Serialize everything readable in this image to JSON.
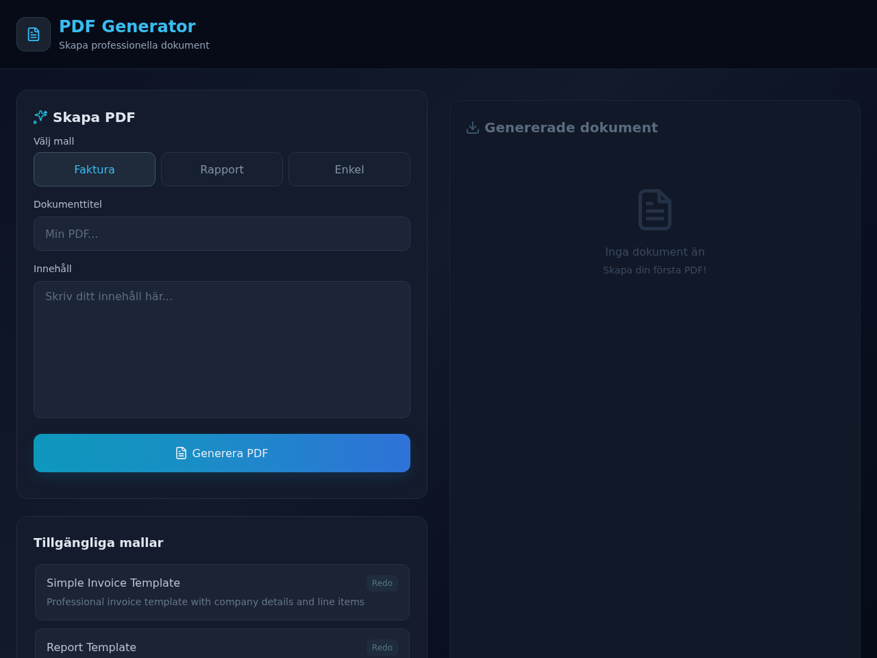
{
  "header": {
    "title": "PDF Generator",
    "subtitle": "Skapa professionella dokument"
  },
  "create_panel": {
    "title": "Skapa PDF",
    "template_label": "Välj mall",
    "template_options": [
      {
        "label": "Faktura",
        "selected": true
      },
      {
        "label": "Rapport",
        "selected": false
      },
      {
        "label": "Enkel",
        "selected": false
      }
    ],
    "title_field": {
      "label": "Dokumenttitel",
      "placeholder": "Min PDF..."
    },
    "content_field": {
      "label": "Innehåll",
      "placeholder": "Skriv ditt innehåll här..."
    },
    "generate_button": "Generera PDF"
  },
  "templates_panel": {
    "title": "Tillgängliga mallar",
    "templates": [
      {
        "name": "Simple Invoice Template",
        "description": "Professional invoice template with company details and line items",
        "status": "Redo"
      },
      {
        "name": "Report Template",
        "status": "Redo"
      }
    ]
  },
  "documents_panel": {
    "title": "Genererade dokument",
    "empty_title": "Inga dokument än",
    "empty_hint": "Skapa din första PDF!"
  }
}
